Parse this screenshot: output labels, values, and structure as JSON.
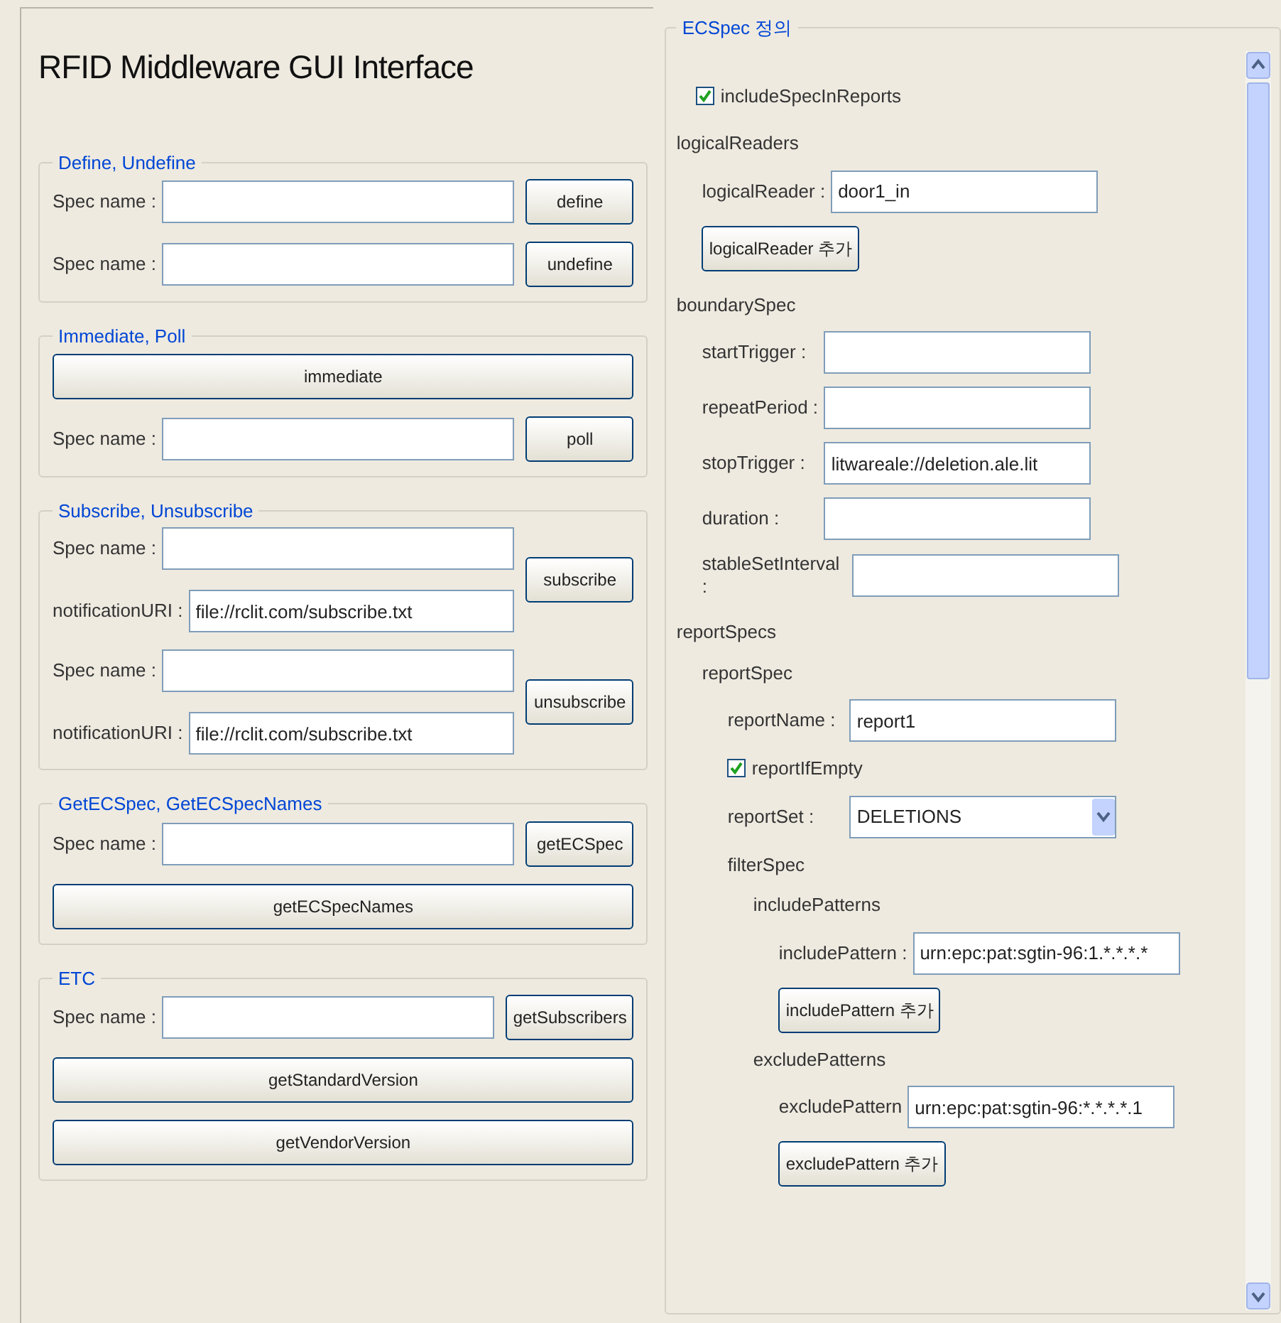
{
  "title": "RFID Middleware GUI Interface",
  "groups": [
    {
      "title": "Define, Undefine",
      "rows": [
        {
          "kind": "field",
          "label": "Spec name :",
          "button": "define"
        },
        {
          "kind": "field",
          "label": "Spec name :",
          "button": "undefine"
        }
      ]
    },
    {
      "title": "Immediate, Poll",
      "rows": [
        {
          "kind": "button",
          "button": "immediate"
        },
        {
          "kind": "field",
          "label": "Spec name :",
          "button": "poll"
        }
      ]
    },
    {
      "title": "Subscribe, Unsubscribe",
      "rows": [
        {
          "kind": "pair",
          "fields": [
            {
              "label": "Spec name :"
            },
            {
              "label": "notificationURI :",
              "value": "file://rclit.com/subscribe.txt"
            }
          ],
          "button": "subscribe"
        },
        {
          "kind": "pair",
          "fields": [
            {
              "label": "Spec name :"
            },
            {
              "label": "notificationURI :",
              "value": "file://rclit.com/subscribe.txt"
            }
          ],
          "button": "unsubscribe"
        }
      ]
    },
    {
      "title": "GetECSpec, GetECSpecNames",
      "rows": [
        {
          "kind": "field",
          "label": "Spec name :",
          "button": "getECSpec"
        },
        {
          "kind": "button",
          "button": "getECSpecNames"
        }
      ]
    },
    {
      "title": "ETC",
      "rows": [
        {
          "kind": "field",
          "label": "Spec name :",
          "button": "getSubscribers"
        },
        {
          "kind": "button",
          "button": "getStandardVersion"
        },
        {
          "kind": "button",
          "button": "getVendorVersion"
        }
      ]
    }
  ],
  "ecspec": {
    "title": "ECSpec 정의",
    "items": [
      {
        "kind": "checkbox",
        "label": "includeSpecInReports",
        "checked": true
      },
      {
        "kind": "heading",
        "label": "logicalReaders",
        "children": [
          {
            "kind": "field",
            "label": "logicalReader :",
            "value": "door1_in"
          },
          {
            "kind": "button",
            "label": "logicalReader 추가"
          }
        ]
      },
      {
        "kind": "heading",
        "label": "boundarySpec",
        "children": [
          {
            "kind": "field",
            "label": "startTrigger :"
          },
          {
            "kind": "field",
            "label": "repeatPeriod :"
          },
          {
            "kind": "field",
            "label": "stopTrigger :",
            "value": "litwareale://deletion.ale.lit"
          },
          {
            "kind": "field",
            "label": "duration :"
          },
          {
            "kind": "field",
            "label": "stableSetInterval :"
          }
        ]
      },
      {
        "kind": "heading",
        "label": "reportSpecs",
        "children": [
          {
            "kind": "heading",
            "label": "reportSpec",
            "children": [
              {
                "kind": "field",
                "label": "reportName :",
                "value": "report1"
              },
              {
                "kind": "checkbox",
                "label": "reportIfEmpty",
                "checked": true
              },
              {
                "kind": "select",
                "label": "reportSet :",
                "value": "DELETIONS"
              },
              {
                "kind": "heading",
                "label": "filterSpec",
                "children": [
                  {
                    "kind": "heading",
                    "label": "includePatterns",
                    "children": [
                      {
                        "kind": "field",
                        "label": "includePattern :",
                        "value": "urn:epc:pat:sgtin-96:1.*.*.*.*"
                      },
                      {
                        "kind": "button",
                        "label": "includePattern 추가"
                      }
                    ]
                  },
                  {
                    "kind": "heading",
                    "label": "excludePatterns",
                    "children": [
                      {
                        "kind": "field",
                        "label": "excludePattern",
                        "value": "urn:epc:pat:sgtin-96:*.*.*.*.1"
                      },
                      {
                        "kind": "button",
                        "label": "excludePattern 추가"
                      }
                    ]
                  }
                ]
              }
            ]
          }
        ]
      }
    ]
  }
}
